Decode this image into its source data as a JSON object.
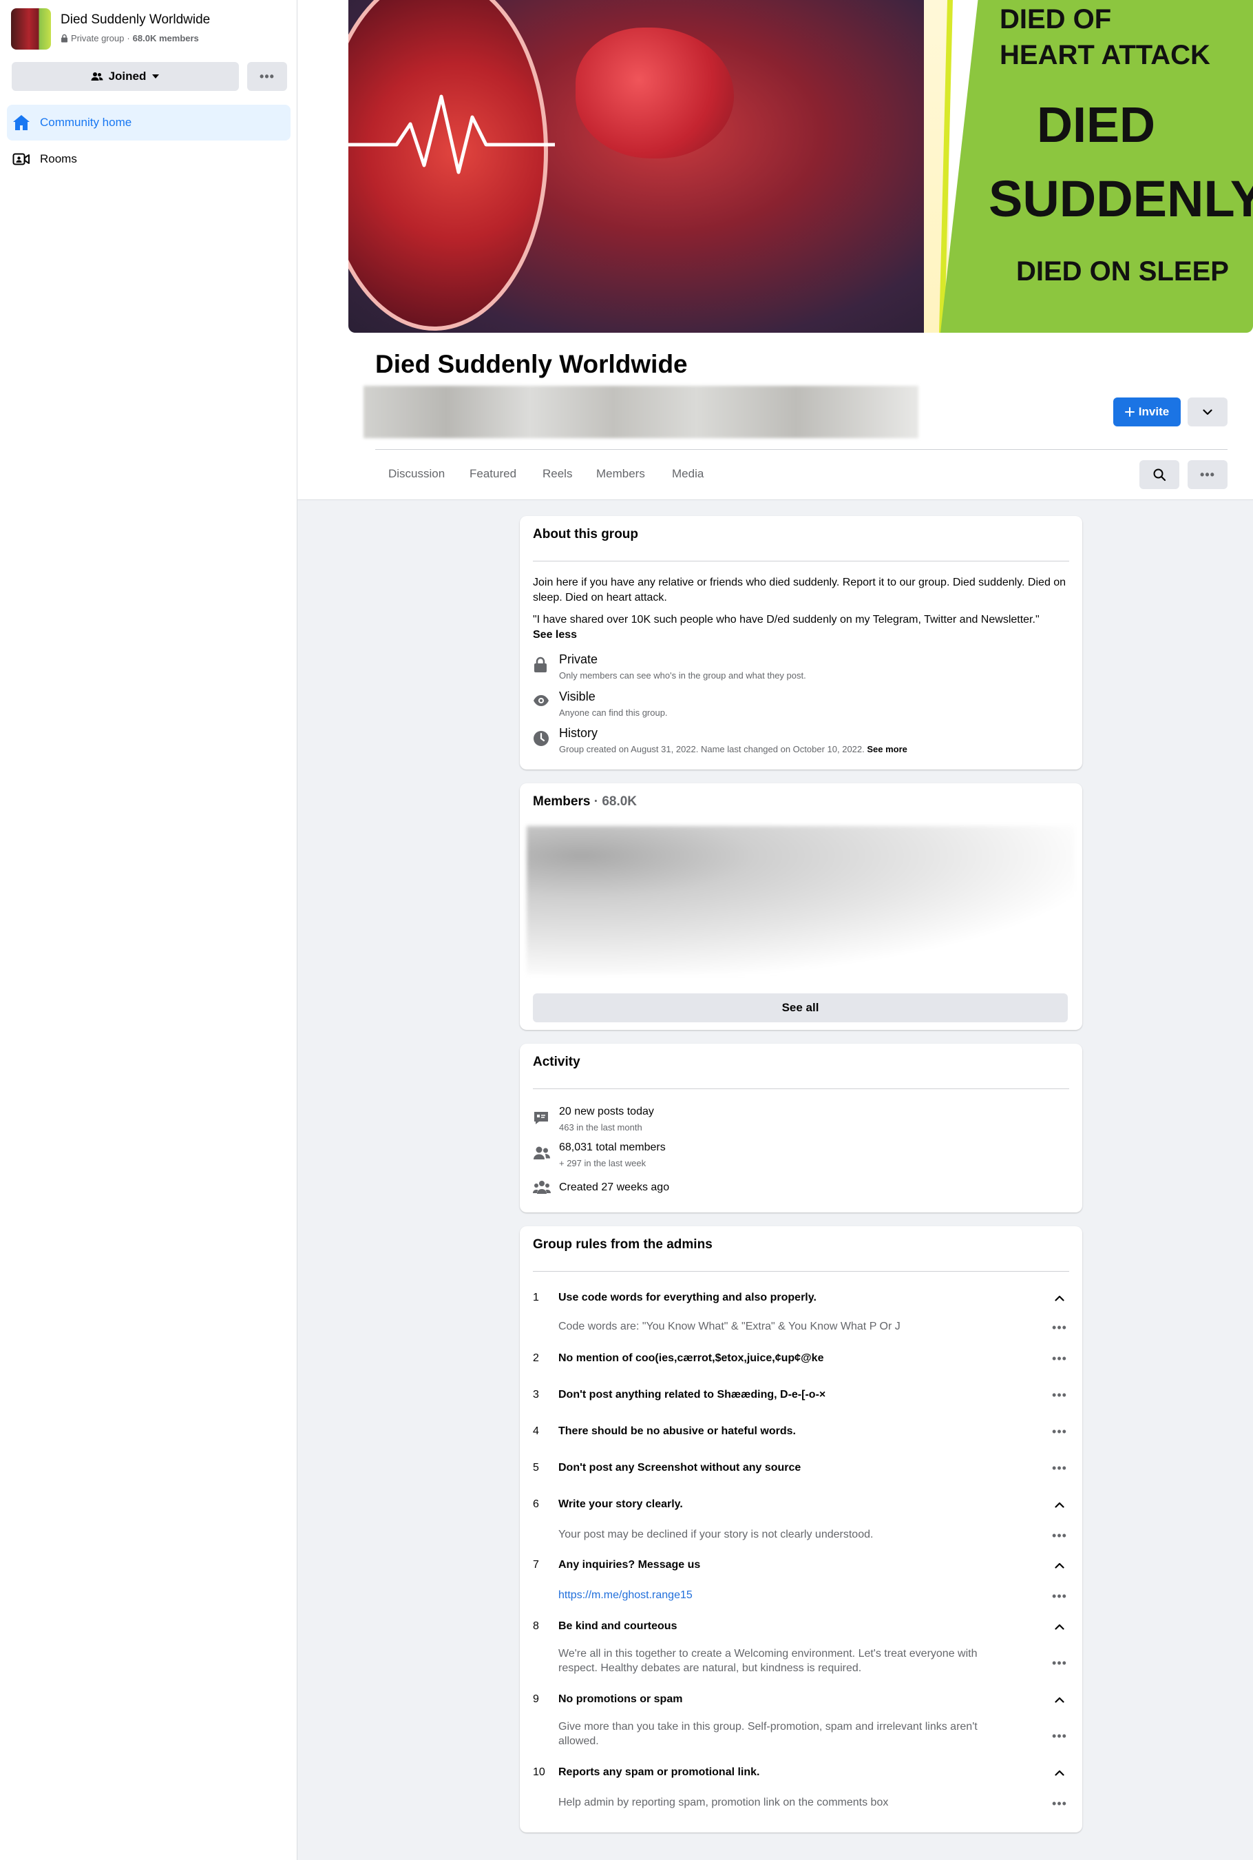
{
  "sidebar": {
    "group_name": "Died Suddenly Worldwide",
    "privacy": "Private group",
    "members_short": "68.0K members",
    "joined_label": "Joined",
    "nav": [
      {
        "label": "Community home"
      },
      {
        "label": "Rooms"
      }
    ]
  },
  "cover": {
    "lines": [
      "DIED OF",
      "HEART ATTACK",
      "DIED",
      "SUDDENLY",
      "DIED ON SLEEP"
    ]
  },
  "header": {
    "title": "Died Suddenly Worldwide",
    "invite_label": "Invite",
    "tabs": [
      {
        "label": "Discussion"
      },
      {
        "label": "Featured"
      },
      {
        "label": "Reels"
      },
      {
        "label": "Members"
      },
      {
        "label": "Media"
      }
    ]
  },
  "about": {
    "title": "About this group",
    "description": "Join here if you have any relative or friends who died suddenly. Report it to our group. Died suddenly. Died on sleep. Died on heart attack.",
    "quote": "\"I have shared over 10K such people who have D/ed suddenly on my Telegram, Twitter and Newsletter.\"",
    "see_less": "See less",
    "private_title": "Private",
    "private_desc": "Only members can see who's in the group and what they post.",
    "visible_title": "Visible",
    "visible_desc": "Anyone can find this group.",
    "history_title": "History",
    "history_desc": "Group created on August 31, 2022. Name last changed on October 10, 2022.",
    "see_more": "See more"
  },
  "members": {
    "title": "Members",
    "separator": " · ",
    "count": "68.0K",
    "see_all": "See all"
  },
  "activity": {
    "title": "Activity",
    "posts_today": "20 new posts today",
    "posts_month": "463 in the last month",
    "total_members": "68,031 total members",
    "members_week": "+ 297 in the last week",
    "created": "Created 27 weeks ago"
  },
  "rules": {
    "title": "Group rules from the admins",
    "items": [
      {
        "num": "1",
        "title": "Use code words for everything and also properly.",
        "desc": "Code words are: \"You Know What\" & \"Extra\" & You Know What P Or J"
      },
      {
        "num": "2",
        "title": "No mention of coo(ies,cærrot,$etox,juice,¢up¢@ke"
      },
      {
        "num": "3",
        "title": "Don't post anything related to Shææding, D-e-[-o-×"
      },
      {
        "num": "4",
        "title": "There should be no abusive or hateful words."
      },
      {
        "num": "5",
        "title": "Don't post any Screenshot without any source"
      },
      {
        "num": "6",
        "title": "Write your story clearly.",
        "desc": "Your post may be declined if your story is not clearly understood."
      },
      {
        "num": "7",
        "title": "Any inquiries? Message us",
        "desc": "https://m.me/ghost.range15"
      },
      {
        "num": "8",
        "title": "Be kind and courteous",
        "desc": "We're all in this together to create a Welcoming environment. Let's treat everyone with respect. Healthy debates are natural, but kindness is required."
      },
      {
        "num": "9",
        "title": "No promotions or spam",
        "desc": "Give more than you take in this group. Self-promotion, spam and irrelevant links aren't allowed."
      },
      {
        "num": "10",
        "title": "Reports any spam or promotional link.",
        "desc": "Help admin by reporting spam, promotion link on the comments box"
      }
    ]
  },
  "colors": {
    "accent": "#1877f2",
    "nav_active_bg": "#e7f3ff",
    "button_grey": "#e4e6eb",
    "page_bg": "#f0f2f5",
    "secondary_text": "#65676b"
  },
  "icons": {
    "lock": "lock-icon",
    "home": "home-icon",
    "rooms": "video-room-icon",
    "people": "people-icon",
    "eye": "eye-icon",
    "clock": "clock-icon",
    "search": "search-icon",
    "more": "more-dots-icon",
    "chevron": "chevron-icon",
    "plus": "plus-icon",
    "chat": "chat-icon"
  }
}
